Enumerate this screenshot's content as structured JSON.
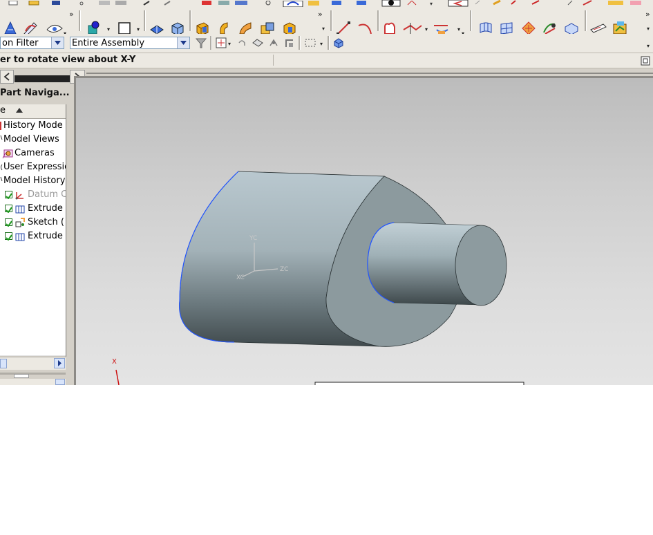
{
  "selection_bar": {
    "type_filter_value": "on Filter",
    "scope_value": "Entire Assembly"
  },
  "cue_line": {
    "message": "er to rotate view about X-Y"
  },
  "part_navigator": {
    "title": "Part Naviga...",
    "column_header": "e",
    "items": [
      {
        "label": "History Mode",
        "checked": false,
        "dimmed": false
      },
      {
        "label": "Model Views",
        "checked": false,
        "dimmed": false
      },
      {
        "label": "Cameras",
        "checked": false,
        "dimmed": false
      },
      {
        "label": "User Expressio",
        "checked": false,
        "dimmed": false
      },
      {
        "label": "Model History",
        "checked": false,
        "dimmed": false
      },
      {
        "label": "Datum C",
        "checked": true,
        "dimmed": true
      },
      {
        "label": "Extrude",
        "checked": true,
        "dimmed": false
      },
      {
        "label": "Sketch (",
        "checked": true,
        "dimmed": false
      },
      {
        "label": "Extrude",
        "checked": true,
        "dimmed": false
      }
    ]
  },
  "viewport": {
    "wcs_labels": {
      "y": "YC",
      "x": "XC",
      "z": "ZC"
    },
    "absolute_axis_label": "X"
  },
  "colors": {
    "toolbar_bg": "#ece9e2",
    "viewport_bg_top": "#bcbcbc",
    "viewport_bg_bottom": "#e4e4e4",
    "edge_highlight": "#2255ff",
    "check_green": "#1f9a1f"
  },
  "icons": [
    "ruler-icon",
    "pencil-icon",
    "render-style-icon",
    "sketch-icon",
    "rectangle-icon",
    "view-orient-icon",
    "cube-icon",
    "extrude-icon",
    "surface-icon",
    "line-icon",
    "arc-icon",
    "feature-icon",
    "transform-icon",
    "snap-icon",
    "filter-icon",
    "layer-icon"
  ]
}
